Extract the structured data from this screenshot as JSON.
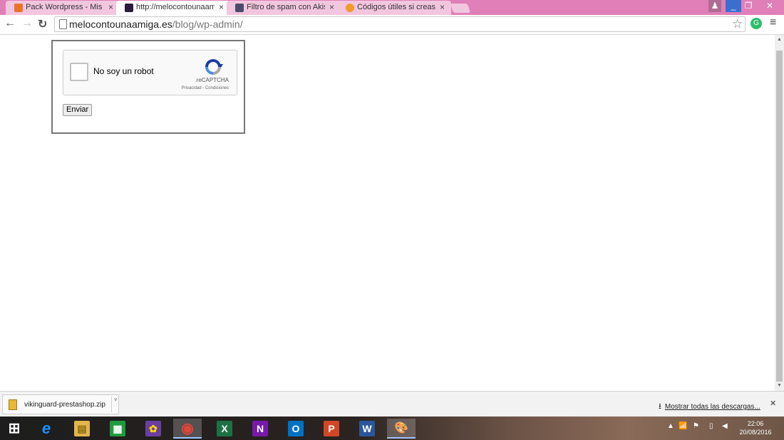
{
  "browser": {
    "tabs": [
      {
        "title": "Pack Wordpress - Mis Ap...",
        "active": false,
        "icon": "pack-favicon-icon",
        "color": "#e8742a"
      },
      {
        "title": "http://melocontounaamig...",
        "active": true,
        "icon": "site-favicon-icon",
        "color": "#2b1b3d"
      },
      {
        "title": "Filtro de spam con Akism...",
        "active": false,
        "icon": "blog-favicon-icon",
        "color": "#4a4a6a"
      },
      {
        "title": "Códigos útiles si creas fo...",
        "active": false,
        "icon": "codigos-favicon-icon",
        "color": "#f29a2e"
      }
    ],
    "tab_close_glyph": "×",
    "window_controls": {
      "user": "♟",
      "minimize": "_",
      "restore": "❐",
      "close": "✕"
    },
    "nav": {
      "back": "←",
      "forward": "→",
      "reload": "↻"
    },
    "url_domain": "melocontounaamiga.es",
    "url_path": "/blog/wp-admin/",
    "bookmark_star": "☆",
    "extension_glyph": "G",
    "menu_glyph": "≡"
  },
  "page": {
    "recaptcha": {
      "label": "No soy un robot",
      "brand": "reCAPTCHA",
      "links": "Privacidad - Condiciones"
    },
    "submit_label": "Enviar"
  },
  "download_shelf": {
    "file_name": "vikinguard-prestashop.zip",
    "dropdown_glyph": "˅",
    "show_all": "Mostrar todas las descargas...",
    "download_glyph": "⭳",
    "close_glyph": "✕"
  },
  "taskbar": {
    "apps": [
      {
        "name": "windows-start-icon",
        "glyph": "⊞",
        "color": "#ffffff"
      },
      {
        "name": "internet-explorer-icon",
        "glyph": "e",
        "color": "#1e90ff"
      },
      {
        "name": "file-explorer-icon",
        "glyph": "▤",
        "color": "#e2b64a"
      },
      {
        "name": "store-icon",
        "glyph": "▦",
        "color": "#1f9b3f"
      },
      {
        "name": "paint-app-icon",
        "glyph": "✿",
        "color": "#6a3fa0"
      },
      {
        "name": "chrome-icon",
        "glyph": "◉",
        "color": "#e0453a"
      },
      {
        "name": "excel-icon",
        "glyph": "X",
        "color": "#1e7145"
      },
      {
        "name": "onenote-icon",
        "glyph": "N",
        "color": "#7719aa"
      },
      {
        "name": "outlook-icon",
        "glyph": "O",
        "color": "#0072c6"
      },
      {
        "name": "powerpoint-icon",
        "glyph": "P",
        "color": "#d24726"
      },
      {
        "name": "word-icon",
        "glyph": "W",
        "color": "#2b579a"
      },
      {
        "name": "paint-palette-icon",
        "glyph": "🎨",
        "color": "#8c9db5"
      }
    ],
    "tray": {
      "up": "▲",
      "signal": "📶",
      "flag": "⚑",
      "battery": "▯",
      "volume": "◀"
    },
    "clock_time": "22:06",
    "clock_date": "20/08/2016"
  },
  "colors": {
    "tabstrip": "#e07fb8",
    "recaptcha_blue": "#1c3aa9"
  }
}
